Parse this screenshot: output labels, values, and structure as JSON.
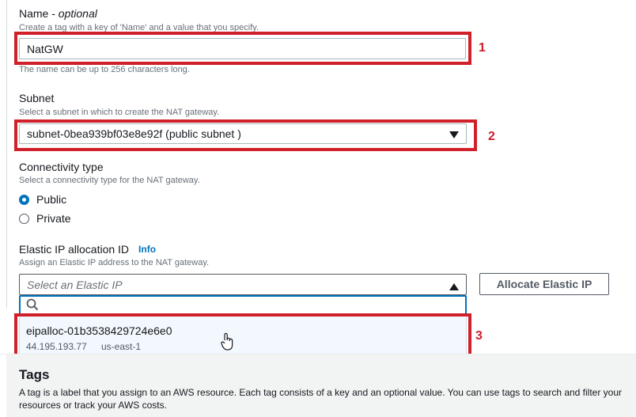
{
  "name_field": {
    "label": "Name - ",
    "label_optional": "optional",
    "description": "Create a tag with a key of 'Name' and a value that you specify.",
    "value": "NatGW",
    "hint": "The name can be up to 256 characters long."
  },
  "subnet_field": {
    "label": "Subnet",
    "description": "Select a subnet in which to create the NAT gateway.",
    "value": "subnet-0bea939bf03e8e92f (public subnet )"
  },
  "connectivity": {
    "label": "Connectivity type",
    "description": "Select a connectivity type for the NAT gateway.",
    "options": [
      "Public",
      "Private"
    ],
    "selected": "Public"
  },
  "elastic_ip": {
    "label": "Elastic IP allocation ID",
    "info": "Info",
    "description": "Assign an Elastic IP address to the NAT gateway.",
    "placeholder": "Select an Elastic IP",
    "allocate_button": "Allocate Elastic IP",
    "option": {
      "id": "eipalloc-01b3538429724e6e0",
      "ip": "44.195.193.77",
      "region": "us-east-1"
    }
  },
  "annotations": [
    "1",
    "2",
    "3"
  ],
  "tags": {
    "title": "Tags",
    "description": "A tag is a label that you assign to an AWS resource. Each tag consists of a key and an optional value. You can use tags to search and filter your resources or track your AWS costs."
  },
  "colors": {
    "accent": "#0073bb",
    "annotation": "#d0202a",
    "muted_text": "#687078"
  }
}
